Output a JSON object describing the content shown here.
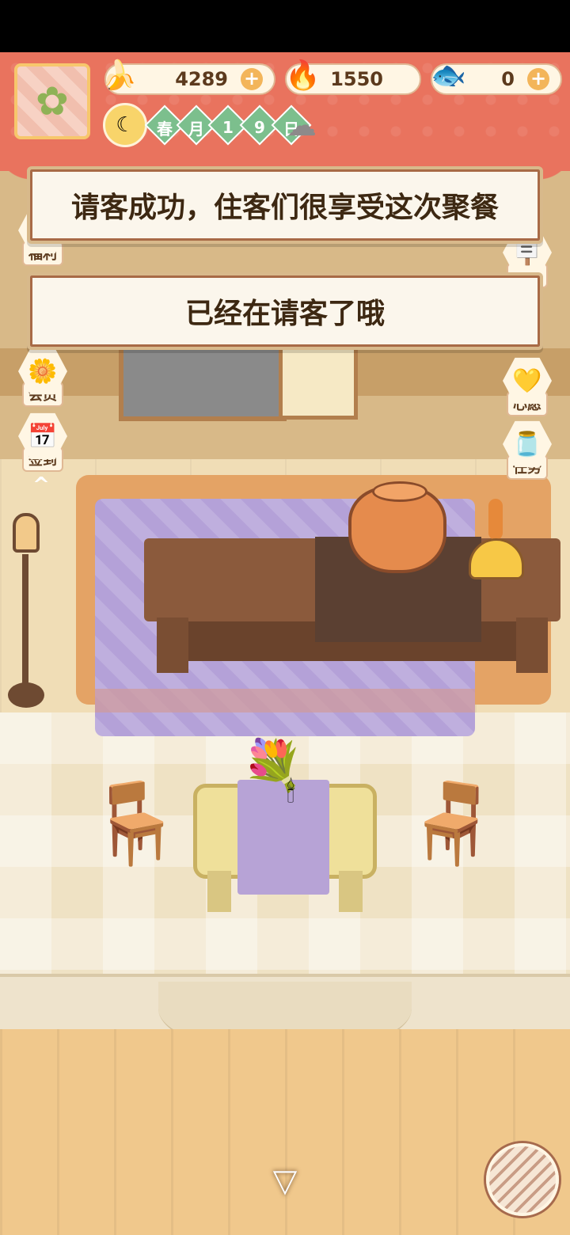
{
  "currencies": {
    "banana": {
      "value": "4289",
      "icon": "banana-icon"
    },
    "fire": {
      "value": "1550",
      "icon": "flame-icon"
    },
    "fish": {
      "value": "0",
      "icon": "fish-icon"
    }
  },
  "date": {
    "season": "春",
    "month": "月",
    "day1": "1",
    "day2": "9",
    "day_suffix": "日",
    "weather_icon": "rain-cloud-icon"
  },
  "side_left": [
    {
      "label": "福利",
      "icon": "gift-icon"
    },
    {
      "label": "会员",
      "icon": "flower-badge-icon"
    },
    {
      "label": "签到",
      "icon": "calendar-check-icon"
    }
  ],
  "side_right": [
    {
      "label": "前往",
      "icon": "signboard-icon"
    },
    {
      "label": "心愿",
      "icon": "heart-icon"
    },
    {
      "label": "任务",
      "icon": "jar-check-icon"
    }
  ],
  "toasts": {
    "primary": "请客成功，住客们很享受这次聚餐",
    "secondary": "已经在请客了哦"
  },
  "controls": {
    "collapse": "^",
    "down_arrow": "▽"
  },
  "colors": {
    "hud_bg": "#e9735e",
    "toast_bg": "#fbf6ec",
    "toast_text": "#3d2812"
  }
}
